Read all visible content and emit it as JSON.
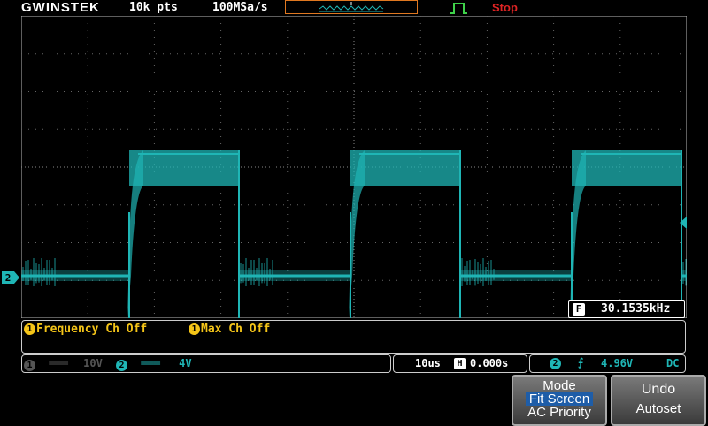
{
  "header": {
    "brand": "GWINSTEK",
    "record_length": "10k pts",
    "sample_rate": "100MSa/s",
    "run_state": "Stop",
    "trigger_mode_icon": "rising-pulse-icon"
  },
  "channel2_marker": "2",
  "frequency_readout": {
    "tag": "F",
    "value": "30.1535kHz"
  },
  "measurements": {
    "item1_badge": "1",
    "item1_label": "Frequency Ch Off",
    "item2_badge": "1",
    "item2_label": "Max Ch Off"
  },
  "status_bar": {
    "ch1_badge": "1",
    "ch1_coupling": "═══",
    "ch1_scale": "10V",
    "ch2_badge": "2",
    "ch2_coupling": "═══",
    "ch2_scale": "4V",
    "timebase": "10us",
    "h_tag": "H",
    "h_position": "0.000s",
    "trig_badge": "2",
    "trig_edge": "⨍",
    "trig_level": "4.96V",
    "trig_coupling": "DC"
  },
  "softkeys": {
    "mode": {
      "title": "Mode",
      "option_selected": "Fit Screen",
      "option_other": "AC Priority"
    },
    "undo": {
      "line1": "Undo",
      "line2": "Autoset"
    }
  },
  "colors": {
    "ch2": "#1fb5b5",
    "ch1": "#f5c518",
    "accent": "#e07820",
    "stop": "#e02424"
  }
}
